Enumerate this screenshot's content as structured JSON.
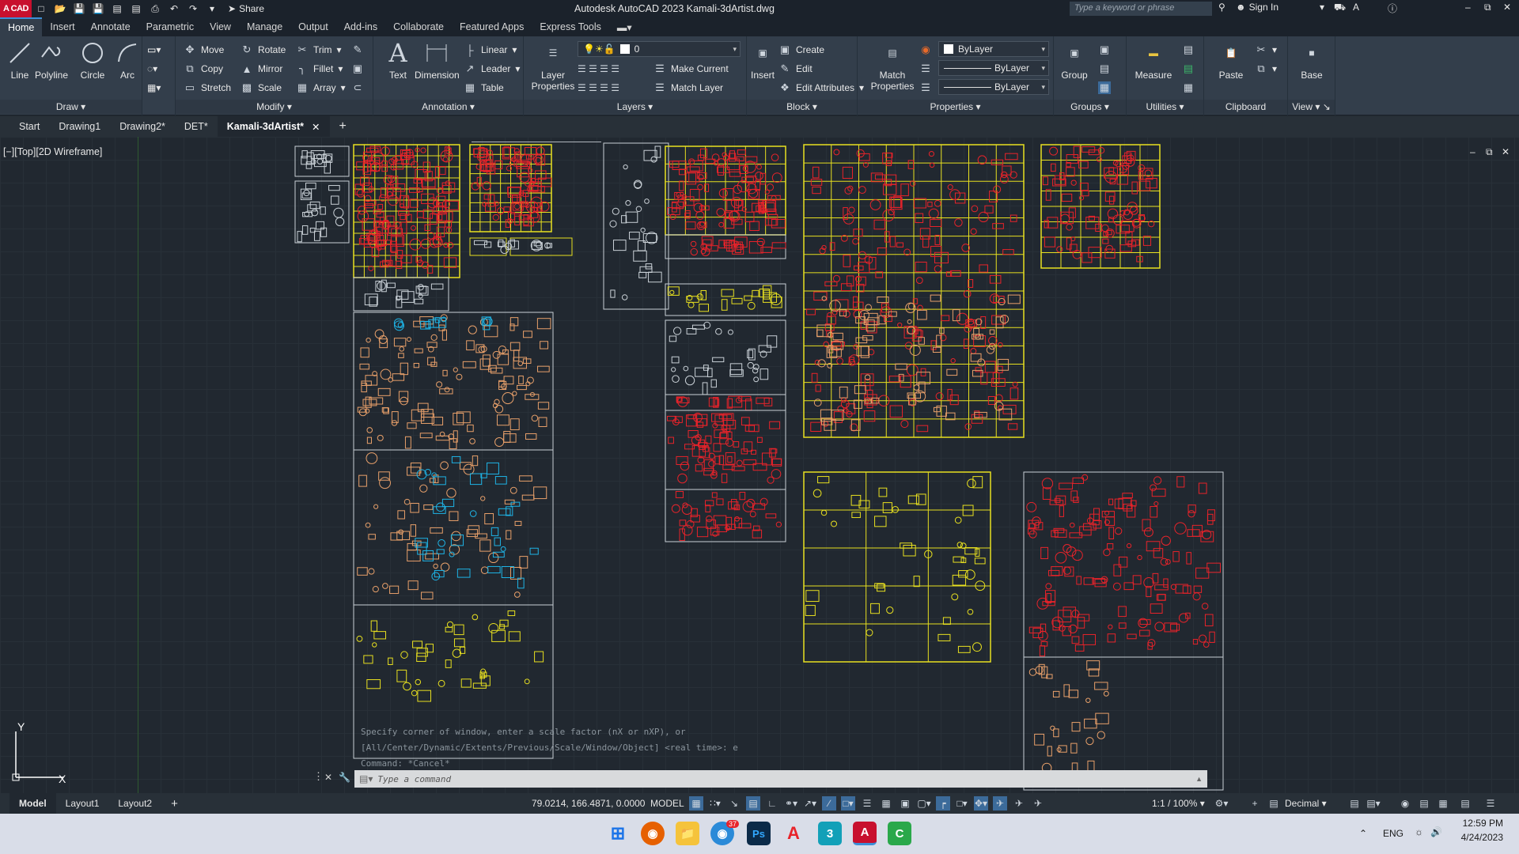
{
  "titlebar": {
    "app_badge": "A CAD",
    "share_label": "Share",
    "title": "Autodesk AutoCAD 2023   Kamali-3dArtist.dwg",
    "search_placeholder": "Type a keyword or phrase",
    "sign_in": "Sign In"
  },
  "ribbon_tabs": [
    "Home",
    "Insert",
    "Annotate",
    "Parametric",
    "View",
    "Manage",
    "Output",
    "Add-ins",
    "Collaborate",
    "Featured Apps",
    "Express Tools"
  ],
  "draw": {
    "title": "Draw",
    "line": "Line",
    "polyline": "Polyline",
    "circle": "Circle",
    "arc": "Arc"
  },
  "modify": {
    "title": "Modify",
    "move": "Move",
    "rotate": "Rotate",
    "trim": "Trim",
    "copy": "Copy",
    "mirror": "Mirror",
    "fillet": "Fillet",
    "stretch": "Stretch",
    "scale": "Scale",
    "array": "Array"
  },
  "annotation": {
    "title": "Annotation",
    "text": "Text",
    "dimension": "Dimension",
    "linear": "Linear",
    "leader": "Leader",
    "table": "Table"
  },
  "layers": {
    "title": "Layers",
    "layer_properties": "Layer Properties",
    "current_layer": "0",
    "make_current": "Make Current",
    "match_layer": "Match Layer"
  },
  "block": {
    "title": "Block",
    "insert": "Insert",
    "create": "Create",
    "edit": "Edit",
    "edit_attributes": "Edit Attributes"
  },
  "properties": {
    "title": "Properties",
    "match_properties": "Match Properties",
    "color": "ByLayer",
    "linetype": "ByLayer",
    "lineweight": "ByLayer"
  },
  "groups": {
    "title": "Groups",
    "group": "Group"
  },
  "utilities": {
    "title": "Utilities",
    "measure": "Measure"
  },
  "clipboard": {
    "title": "Clipboard",
    "paste": "Paste"
  },
  "view_panel": {
    "title": "View",
    "base": "Base"
  },
  "file_tabs": [
    "Start",
    "Drawing1",
    "Drawing2*",
    "DET*",
    "Kamali-3dArtist*"
  ],
  "viewport": {
    "label": "[−][Top][2D Wireframe]",
    "ucs_x": "X",
    "ucs_y": "Y"
  },
  "command": {
    "history": [
      "Specify corner of window, enter a scale factor (nX or nXP), or",
      "[All/Center/Dynamic/Extents/Previous/Scale/Window/Object] <real time>: e",
      "Command: *Cancel*"
    ],
    "placeholder": "Type a command"
  },
  "status": {
    "layout_tabs": [
      "Model",
      "Layout1",
      "Layout2"
    ],
    "coords": "79.0214, 166.4871, 0.0000",
    "model": "MODEL",
    "scale": "1:1 / 100%",
    "units": "Decimal"
  },
  "taskbar": {
    "lang": "ENG",
    "time": "12:59 PM",
    "date": "4/24/2023",
    "chrome_badge": "37"
  },
  "colors": {
    "accent": "#3c8fd8",
    "yellow": "#e8e020",
    "red": "#e8232a",
    "orange": "#e8a06a",
    "cyan": "#1eb4e6",
    "white": "#c9d0d6"
  }
}
